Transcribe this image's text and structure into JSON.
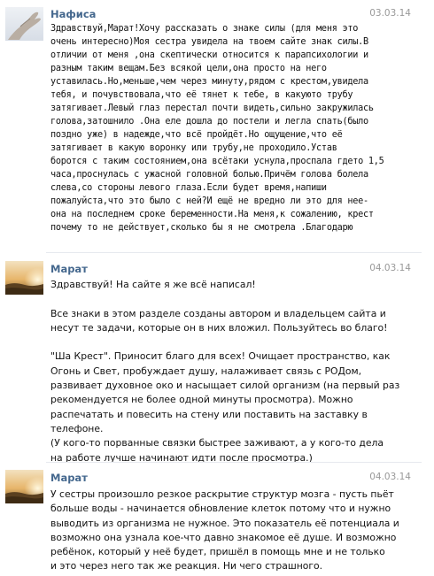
{
  "comments": [
    {
      "author": "Нафиса",
      "date": "03.03.14",
      "avatar_icon": "hand-avatar-icon",
      "text": "Здравствуй,Марат!Хочу рассказать о знаке силы (для меня это\nочень интересно)Моя сестра увидела на твоем сайте знак силы.В\nотличии от меня ,она скептически относится к парапсихологии и\nразным таким вещам.Без всякой цели,она просто на него\nуставилась.Но,меньше,чем через минуту,рядом с крестом,увидела\nтебя, и почувствовала,что её тянет к тебе, в какуюто трубу\nзатягивает.Левый глаз перестал почти видеть,сильно закружилась\nголова,затошнило .Она еле дошла до постели и легла спать(было\nпоздно уже) в надежде,что всё пройдёт.Но ощущение,что её\nзатягивает в какую воронку или трубу,не проходило.Устав\nборотся с таким состоянием,она всётаки уснула,проспала гдето 1,5\nчаса,проснулась с ужасной головной болью.Причём голова болела\nслева,со стороны левого глаза.Если будет время,напиши\nпожалуйста,что это было с ней?И ещё не вредно ли это для нее-\nона на последнем сроке беременности.На меня,к сожалению, крест\nпочему то не действует,сколько бы я не смотрела .Благодарю"
    },
    {
      "author": "Марат",
      "date": "04.03.14",
      "avatar_icon": "sunset-avatar-icon",
      "text": "Здравствуй! На сайте я же всё написал!\n\nВсе знаки в этом разделе созданы автором и владельцем сайта и\nнесут те задачи, которые он в них вложил. Пользуйтесь во благо!\n\n\"Ша Крест\". Приносит благо для всех! Очищает пространство, как\nОгонь и Свет, пробуждает душу, налаживает связь с РОДом,\nразвивает духовное око и насыщает силой организм (на первый раз\nрекомендуется не более одной минуты просмотра). Можно\nраспечатать и повесить на стену или поставить на заставку в\nтелефоне.\n(У кого-то порванные связки быстрее заживают, а у кого-то дела\nна работе лучше начинают идти после просмотра.)"
    },
    {
      "author": "Марат",
      "date": "04.03.14",
      "avatar_icon": "sunset-avatar-icon",
      "text": "У сестры произошло резкое раскрытие структур мозга - пусть пьёт\nбольше воды - начинается обновление клеток потому что и нужно\nвыводить из организма не нужное. Это показатель её потенциала и\nвозможно она узнала кое-что давно знакомое её душе. И возможно\nребёнок, который у неё будет, пришёл в помощь мне и не только\nи это через него так же реакция. Ни чего страшного."
    }
  ]
}
